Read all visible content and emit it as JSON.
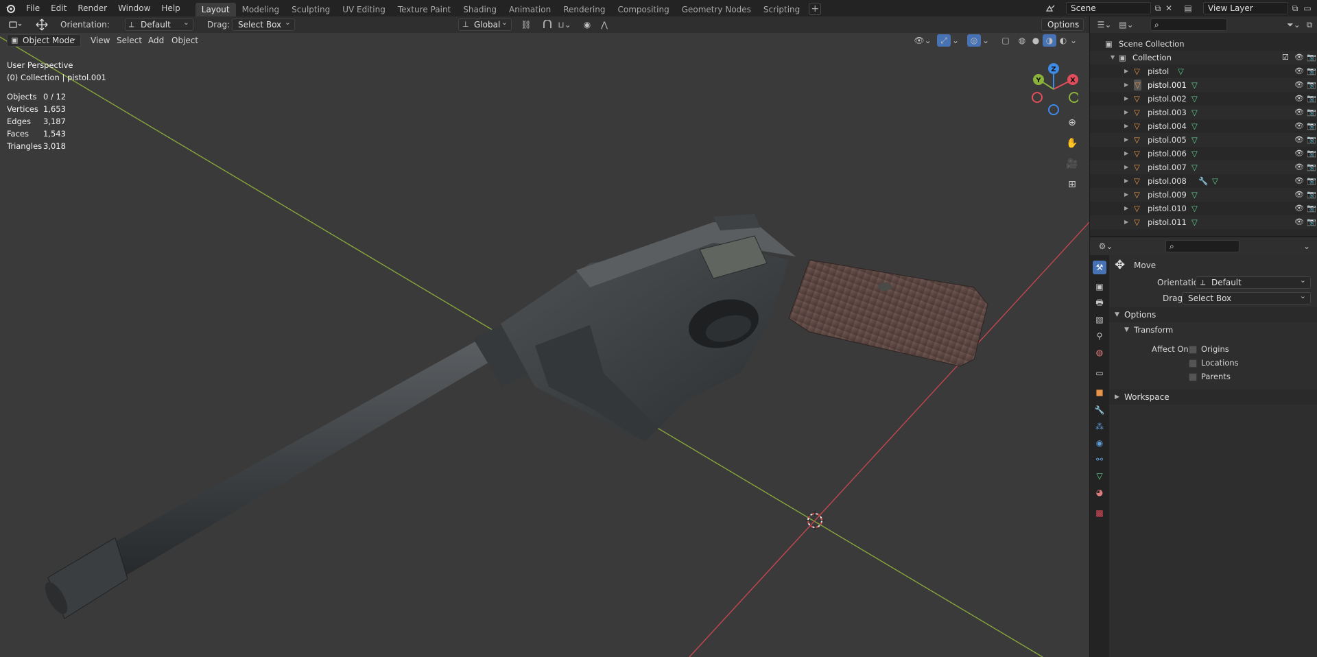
{
  "menu": [
    "File",
    "Edit",
    "Render",
    "Window",
    "Help"
  ],
  "workspaces": [
    "Layout",
    "Modeling",
    "Sculpting",
    "UV Editing",
    "Texture Paint",
    "Shading",
    "Animation",
    "Rendering",
    "Compositing",
    "Geometry Nodes",
    "Scripting"
  ],
  "workspace_add": "+",
  "scene": {
    "name": "Scene",
    "view_layer": "View Layer"
  },
  "tool_header": {
    "orientation_label": "Orientation:",
    "orientation_value": "Default",
    "drag_label": "Drag:",
    "drag_value": "Select Box",
    "transform_space": "Global",
    "options": "Options"
  },
  "viewport_header": {
    "mode": "Object Mode",
    "menus": [
      "View",
      "Select",
      "Add",
      "Object"
    ]
  },
  "overlay": {
    "perspective": "User Perspective",
    "collection": "(0) Collection | pistol.001",
    "stats": [
      {
        "label": "Objects",
        "value": "0 / 12"
      },
      {
        "label": "Vertices",
        "value": "1,653"
      },
      {
        "label": "Edges",
        "value": "3,187"
      },
      {
        "label": "Faces",
        "value": "1,543"
      },
      {
        "label": "Triangles",
        "value": "3,018"
      }
    ]
  },
  "gizmo": {
    "x": "X",
    "y": "Y",
    "z": "Z"
  },
  "outliner": {
    "root": "Scene Collection",
    "collection": "Collection",
    "objects": [
      "pistol",
      "pistol.001",
      "pistol.002",
      "pistol.003",
      "pistol.004",
      "pistol.005",
      "pistol.006",
      "pistol.007",
      "pistol.008",
      "pistol.009",
      "pistol.010",
      "pistol.011"
    ],
    "selected": "pistol.001"
  },
  "properties": {
    "tool_name": "Move",
    "orientation_label": "Orientation",
    "orientation_value": "Default",
    "drag_label": "Drag:",
    "drag_value": "Select Box",
    "options_section": "Options",
    "transform_section": "Transform",
    "affect_only_label": "Affect Only",
    "affect_only": [
      "Origins",
      "Locations",
      "Parents"
    ],
    "workspace_section": "Workspace"
  },
  "colors": {
    "accent": "#4772b3",
    "object_orange": "#e8944a",
    "mesh_green": "#5fd18f",
    "axis_x": "#e44d5c",
    "axis_y": "#8bb33a",
    "axis_z": "#3f8be8"
  }
}
